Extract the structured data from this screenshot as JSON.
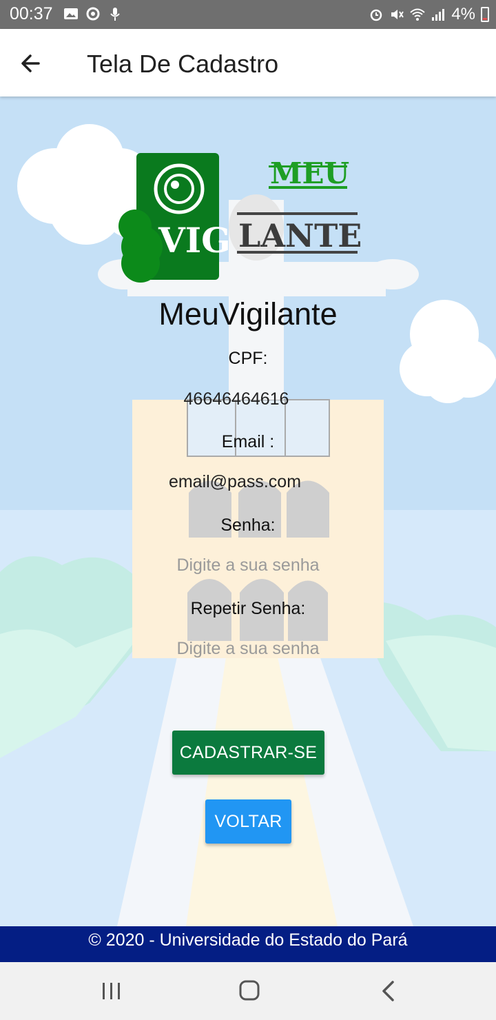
{
  "status_bar": {
    "time": "00:37",
    "battery": "4%",
    "left_icons": [
      "image-icon",
      "sync-icon",
      "mic-icon"
    ],
    "right_icons": [
      "alarm-icon",
      "mute-icon",
      "wifi-icon",
      "signal-icon",
      "battery-icon"
    ]
  },
  "app_bar": {
    "title": "Tela De Cadastro",
    "back_icon": "arrow-left-icon"
  },
  "logo": {
    "word_top": "MEU",
    "word_left": "VIG",
    "word_right": "LANTE",
    "brand_color": "#0a7a1e"
  },
  "form": {
    "app_name": "MeuVigilante",
    "cpf_label": "CPF:",
    "cpf_value": "46646464616",
    "email_label": "Email :",
    "email_value": "email@pass.com",
    "password_label": "Senha:",
    "password_placeholder": "Digite a sua senha",
    "repeat_password_label": "Repetir Senha:",
    "repeat_password_placeholder": "Digite a sua senha"
  },
  "buttons": {
    "register_label": "CADASTRAR-SE",
    "register_color": "#0b7a3e",
    "back_label": "VOLTAR",
    "back_color": "#2196f3"
  },
  "footer": {
    "text": "© 2020 - Universidade do Estado do Pará",
    "color": "#041e84"
  },
  "nav_bar": {
    "icons": [
      "recent-apps-icon",
      "home-icon",
      "back-icon"
    ]
  }
}
